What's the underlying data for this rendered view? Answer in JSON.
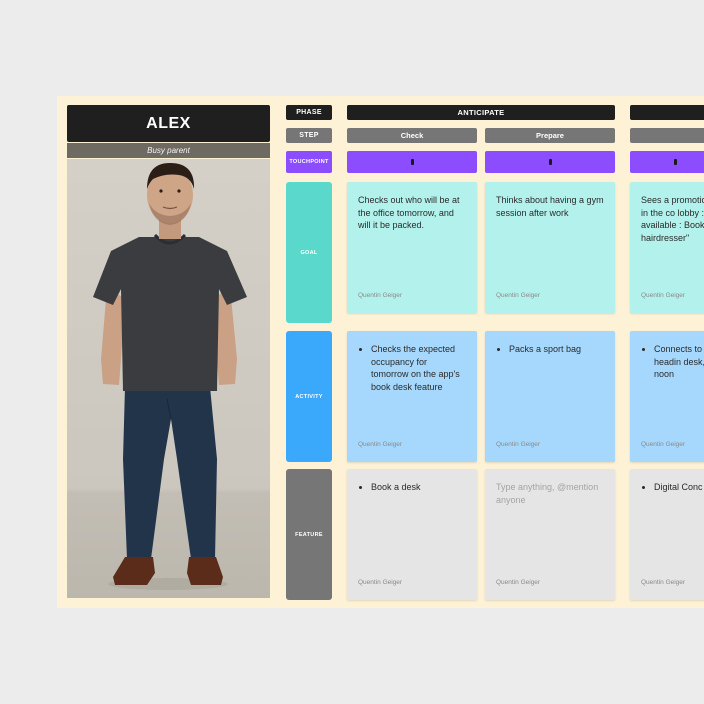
{
  "persona": {
    "name": "ALEX",
    "role": "Busy parent"
  },
  "rows": {
    "phase": "PHASE",
    "step": "STEP",
    "touchpoint": "TOUCHPOINT",
    "goal": "GOAL",
    "activity": "ACTIVITY",
    "feature": "FEATURE"
  },
  "phases": [
    {
      "label": "ANTICIPATE"
    },
    {
      "label": ""
    }
  ],
  "steps": [
    {
      "label": "Check"
    },
    {
      "label": "Prepare"
    },
    {
      "label": ""
    }
  ],
  "goals": [
    {
      "text": "Checks out who will be at the office tomorrow, and will it be packed.",
      "author": "Quentin Geiger"
    },
    {
      "text": "Thinks about having a gym session after work",
      "author": "Quentin Geiger"
    },
    {
      "text": "Sees a promotio screen in the co lobby : \"New se available : Book hairdresser\"",
      "author": "Quentin Geiger"
    }
  ],
  "activities": [
    {
      "text": "Checks the expected occupancy for tomorrow on the app's book desk feature",
      "author": "Quentin Geiger"
    },
    {
      "text": "Packs a sport bag",
      "author": "Quentin Geiger"
    },
    {
      "text": "Connects to he is headin desk, and bo for noon",
      "author": "Quentin Geiger"
    }
  ],
  "features": [
    {
      "text": "Book a desk",
      "author": "Quentin Geiger"
    },
    {
      "placeholder": "Type anything, @mention anyone",
      "author": "Quentin Geiger"
    },
    {
      "text": "Digital Conc",
      "author": "Quentin Geiger"
    }
  ],
  "icons": {
    "touchpoint": "phone-icon"
  },
  "colors": {
    "board": "#fdf1d6",
    "phase": "#1f1f1f",
    "step": "#767676",
    "touchpoint": "#8b4dff",
    "goal_label": "#5ad8cc",
    "goal_card": "#b3f2ec",
    "activity_label": "#3aa8fb",
    "activity_card": "#a6d8fd",
    "feature_label": "#767676",
    "feature_card": "#e5e5e5"
  }
}
